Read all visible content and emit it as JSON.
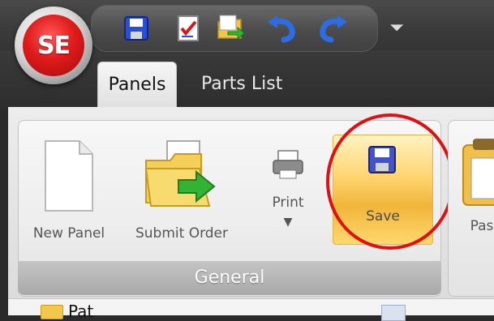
{
  "app": {
    "logo_text": "SE"
  },
  "tabs": [
    {
      "label": "Panels",
      "active": true
    },
    {
      "label": "Parts List",
      "active": false
    }
  ],
  "quick_access": [
    {
      "name": "save-icon"
    },
    {
      "name": "checklist-icon"
    },
    {
      "name": "folder-arrow-icon"
    },
    {
      "name": "undo-icon"
    },
    {
      "name": "redo-icon"
    },
    {
      "name": "customize-dropdown-icon"
    }
  ],
  "ribbon": {
    "group_label": "General",
    "buttons": {
      "new_panel": "New Panel",
      "submit_order": "Submit Order",
      "print": "Print",
      "save": "Save",
      "paste_partial": "Pas"
    }
  },
  "tree": {
    "item_partial": "Pat"
  },
  "colors": {
    "highlight_circle": "#e01010",
    "save_highlight": "#f3b53a"
  }
}
